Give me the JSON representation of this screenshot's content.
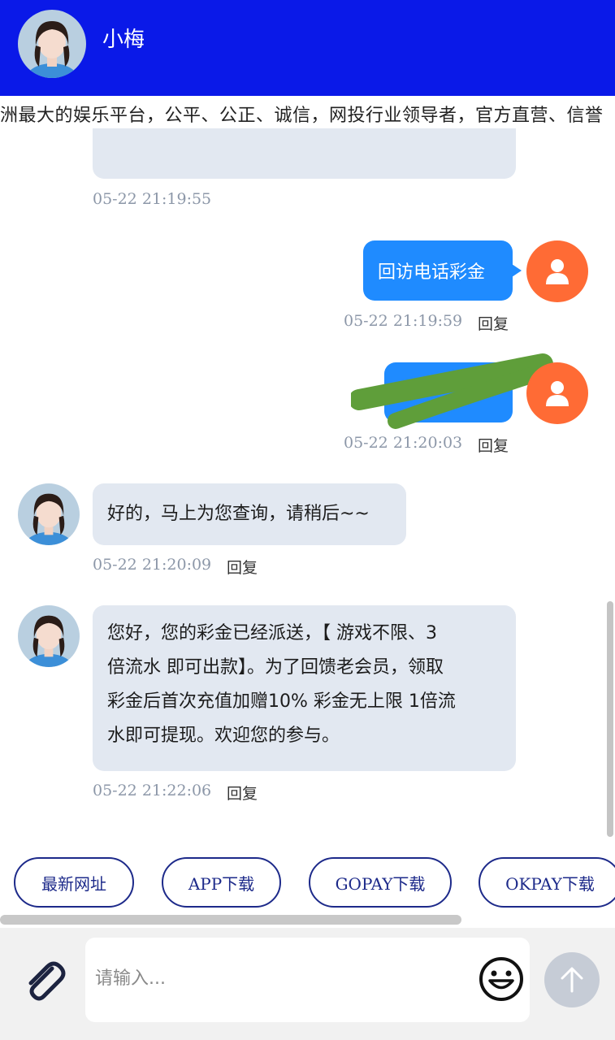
{
  "header": {
    "title": "小梅"
  },
  "marquee": {
    "text": "洲最大的娱乐平台，公平、公正、诚信，网投行业领导者，官方直营、信誉"
  },
  "messages": [
    {
      "side": "in",
      "text": "",
      "time": "05-22 21:19:55",
      "reply": ""
    },
    {
      "side": "out",
      "text": "回访电话彩金",
      "time": "05-22 21:19:59",
      "reply": "回复"
    },
    {
      "side": "out",
      "text": "",
      "time": "05-22 21:20:03",
      "reply": "回复",
      "redacted": true
    },
    {
      "side": "in",
      "text": "好的，马上为您查询，请稍后~~",
      "time": "05-22 21:20:09",
      "reply": "回复"
    },
    {
      "side": "in",
      "lines": [
        "您好，您的彩金已经派送，【 游戏不限、3",
        "倍流水 即可出款】。为了回馈老会员，领取",
        "彩金后首次充值加赠10% 彩金无上限 1倍流",
        "水即可提现。欢迎您的参与。"
      ],
      "time": "05-22 21:22:06",
      "reply": "回复"
    }
  ],
  "quick_links": [
    "最新网址",
    "APP下载",
    "GOPAY下载",
    "OKPAY下载"
  ],
  "input": {
    "placeholder": "请输入..."
  },
  "colors": {
    "header": "#0a19e8",
    "bubble_in": "#e2e8f1",
    "bubble_out": "#1f8bff",
    "user_avatar": "#ff6b35",
    "pill_border": "#1d2a8a"
  },
  "icons": {
    "attach": "paperclip-icon",
    "emoji": "smiley-icon",
    "send": "arrow-up-icon",
    "user": "user-icon"
  }
}
